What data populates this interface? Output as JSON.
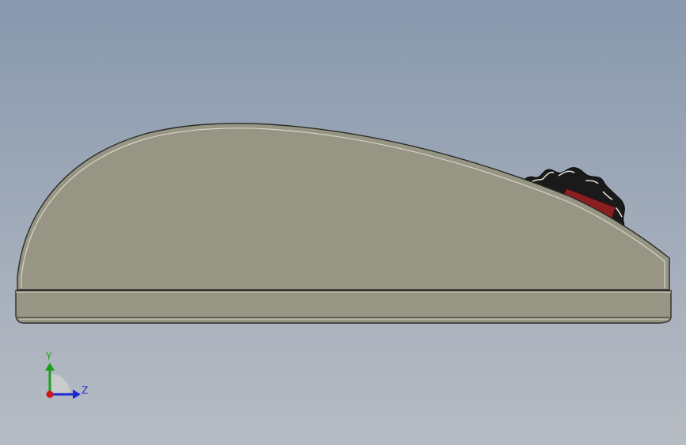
{
  "viewport": {
    "background_top": "#8898ad",
    "background_bottom": "#b7bcc4"
  },
  "model": {
    "body_color": "#979684",
    "edge_color": "#2b2b26",
    "wheel_color": "#1a1a1a",
    "wheel_insert_color": "#8a1f1f"
  },
  "triad": {
    "y_label": "Y",
    "z_label": "Z",
    "y_color": "#1aa01a",
    "z_color": "#1a2bd0",
    "x_color": "#c81818"
  }
}
